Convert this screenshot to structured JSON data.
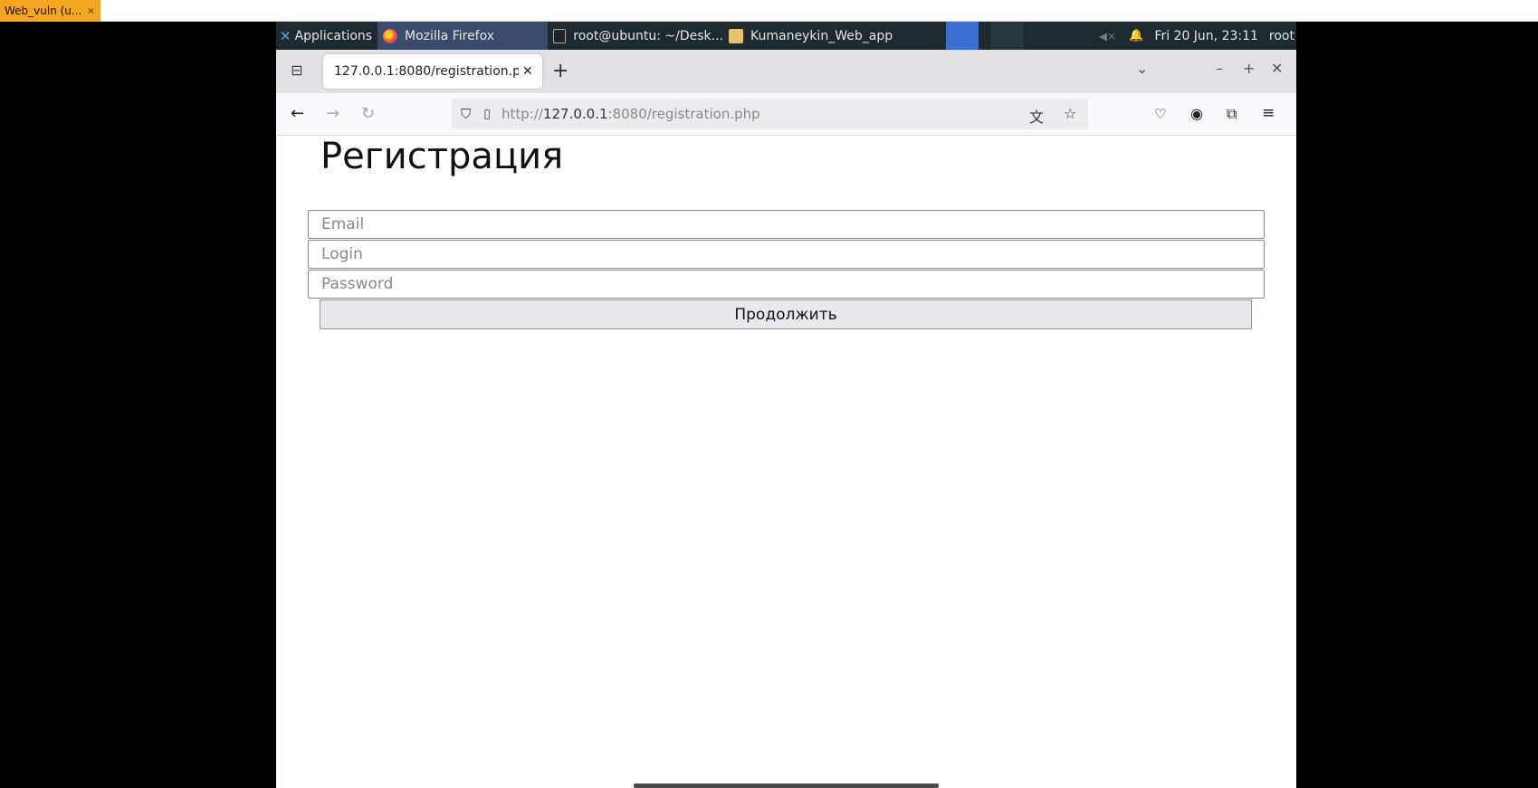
{
  "host": {
    "tab_label": "Web_vuln (u...",
    "tab_close": "×"
  },
  "panel": {
    "applications": "Applications",
    "tasks": [
      {
        "label": "Mozilla Firefox",
        "icon": "firefox-icon"
      },
      {
        "label": "root@ubuntu: ~/Desk...",
        "icon": "terminal-icon"
      },
      {
        "label": "Kumaneykin_Web_app",
        "icon": "folder-icon"
      }
    ],
    "clock": "Fri 20 Jun, 23:11",
    "user": "root"
  },
  "browser": {
    "tab_title": "127.0.0.1:8080/registration.php",
    "url_prefix": "http://",
    "url_host": "127.0.0.1",
    "url_rest": ":8080/registration.php"
  },
  "page": {
    "heading": "Регистрация",
    "email_placeholder": "Email",
    "login_placeholder": "Login",
    "password_placeholder": "Password",
    "submit_label": "Продолжить"
  }
}
